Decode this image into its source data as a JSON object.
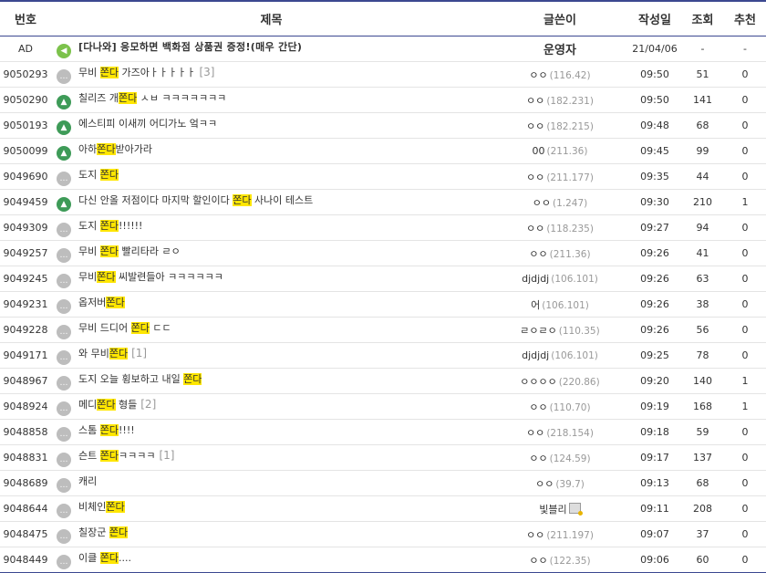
{
  "header": {
    "num": "번호",
    "title": "제목",
    "writer": "글쓴이",
    "date": "작성일",
    "views": "조회",
    "recommend": "추천"
  },
  "ad": {
    "num": "AD",
    "title": "[다나와] 응모하면 백화점 상품권 증정!(매우 간단)",
    "writer": "운영자",
    "date": "21/04/06",
    "views": "-",
    "recommend": "-",
    "icon": "speaker-icon"
  },
  "rows": [
    {
      "num": "9050293",
      "icon": "text",
      "pre": "무비 ",
      "hl": "쫀다",
      "post": " 가즈아ㅏㅏㅏㅏㅏ",
      "cmt": "[3]",
      "writer": "ㅇㅇ",
      "ip": "(116.42)",
      "date": "09:50",
      "views": "51",
      "rec": "0"
    },
    {
      "num": "9050290",
      "icon": "image",
      "pre": "칠리즈 개",
      "hl": "쫀다",
      "post": " ㅅㅂ ㅋㅋㅋㅋㅋㅋㅋ",
      "cmt": "",
      "writer": "ㅇㅇ",
      "ip": "(182.231)",
      "date": "09:50",
      "views": "141",
      "rec": "0"
    },
    {
      "num": "9050193",
      "icon": "image",
      "pre": "에스티피 이새끼 어디가노 엌ㅋㅋ",
      "hl": "",
      "post": "",
      "cmt": "",
      "writer": "ㅇㅇ",
      "ip": "(182.215)",
      "date": "09:48",
      "views": "68",
      "rec": "0"
    },
    {
      "num": "9050099",
      "icon": "image",
      "pre": "아하",
      "hl": "쫀다",
      "post": "받아가라",
      "cmt": "",
      "writer": "00",
      "ip": "(211.36)",
      "date": "09:45",
      "views": "99",
      "rec": "0"
    },
    {
      "num": "9049690",
      "icon": "text",
      "pre": "도지 ",
      "hl": "쫀다",
      "post": "",
      "cmt": "",
      "writer": "ㅇㅇ",
      "ip": "(211.177)",
      "date": "09:35",
      "views": "44",
      "rec": "0"
    },
    {
      "num": "9049459",
      "icon": "image",
      "pre": "다신 안올 저점이다 마지막 할인이다 ",
      "hl": "쫀다",
      "post": " 사나이 테스트",
      "cmt": "",
      "writer": "ㅇㅇ",
      "ip": "(1.247)",
      "date": "09:30",
      "views": "210",
      "rec": "1"
    },
    {
      "num": "9049309",
      "icon": "text",
      "pre": "도지 ",
      "hl": "쫀다",
      "post": "!!!!!!",
      "cmt": "",
      "writer": "ㅇㅇ",
      "ip": "(118.235)",
      "date": "09:27",
      "views": "94",
      "rec": "0"
    },
    {
      "num": "9049257",
      "icon": "text",
      "pre": "무비 ",
      "hl": "쫀다",
      "post": " 빨리타라 ㄹㅇ",
      "cmt": "",
      "writer": "ㅇㅇ",
      "ip": "(211.36)",
      "date": "09:26",
      "views": "41",
      "rec": "0"
    },
    {
      "num": "9049245",
      "icon": "text",
      "pre": "무비",
      "hl": "쫀다",
      "post": " 씨발련들아 ㅋㅋㅋㅋㅋㅋ",
      "cmt": "",
      "writer": "djdjdj",
      "ip": "(106.101)",
      "date": "09:26",
      "views": "63",
      "rec": "0"
    },
    {
      "num": "9049231",
      "icon": "text",
      "pre": "옵저버",
      "hl": "쫀다",
      "post": "",
      "cmt": "",
      "writer": "어",
      "ip": "(106.101)",
      "date": "09:26",
      "views": "38",
      "rec": "0"
    },
    {
      "num": "9049228",
      "icon": "text",
      "pre": "무비 드디어 ",
      "hl": "쫀다",
      "post": " ㄷㄷ",
      "cmt": "",
      "writer": "ㄹㅇㄹㅇ",
      "ip": "(110.35)",
      "date": "09:26",
      "views": "56",
      "rec": "0"
    },
    {
      "num": "9049171",
      "icon": "text",
      "pre": "와 무비",
      "hl": "쫀다",
      "post": "",
      "cmt": "[1]",
      "writer": "djdjdj",
      "ip": "(106.101)",
      "date": "09:25",
      "views": "78",
      "rec": "0"
    },
    {
      "num": "9048967",
      "icon": "text",
      "pre": "도지 오늘 횡보하고 내일 ",
      "hl": "쫀다",
      "post": "",
      "cmt": "",
      "writer": "ㅇㅇㅇㅇ",
      "ip": "(220.86)",
      "date": "09:20",
      "views": "140",
      "rec": "1"
    },
    {
      "num": "9048924",
      "icon": "text",
      "pre": "메디",
      "hl": "쫀다",
      "post": " 형들",
      "cmt": "[2]",
      "writer": "ㅇㅇ",
      "ip": "(110.70)",
      "date": "09:19",
      "views": "168",
      "rec": "1"
    },
    {
      "num": "9048858",
      "icon": "text",
      "pre": "스톰 ",
      "hl": "쫀다",
      "post": "!!!!",
      "cmt": "",
      "writer": "ㅇㅇ",
      "ip": "(218.154)",
      "date": "09:18",
      "views": "59",
      "rec": "0"
    },
    {
      "num": "9048831",
      "icon": "text",
      "pre": "슨트 ",
      "hl": "쫀다",
      "post": "ㅋㅋㅋㅋ",
      "cmt": "[1]",
      "writer": "ㅇㅇ",
      "ip": "(124.59)",
      "date": "09:17",
      "views": "137",
      "rec": "0"
    },
    {
      "num": "9048689",
      "icon": "text",
      "pre": "캐리",
      "hl": "",
      "post": "",
      "cmt": "",
      "writer": "ㅇㅇ",
      "ip": "(39.7)",
      "date": "09:13",
      "views": "68",
      "rec": "0"
    },
    {
      "num": "9048644",
      "icon": "text",
      "pre": "비체인",
      "hl": "쫀다",
      "post": "",
      "cmt": "",
      "writer": "빛블리",
      "ip": "",
      "badge": true,
      "date": "09:11",
      "views": "208",
      "rec": "0"
    },
    {
      "num": "9048475",
      "icon": "text",
      "pre": "칠장군 ",
      "hl": "쫀다",
      "post": "",
      "cmt": "",
      "writer": "ㅇㅇ",
      "ip": "(211.197)",
      "date": "09:07",
      "views": "37",
      "rec": "0"
    },
    {
      "num": "9048449",
      "icon": "text",
      "pre": "이클 ",
      "hl": "쫀다",
      "post": "....",
      "cmt": "",
      "writer": "ㅇㅇ",
      "ip": "(122.35)",
      "date": "09:06",
      "views": "60",
      "rec": "0"
    }
  ]
}
